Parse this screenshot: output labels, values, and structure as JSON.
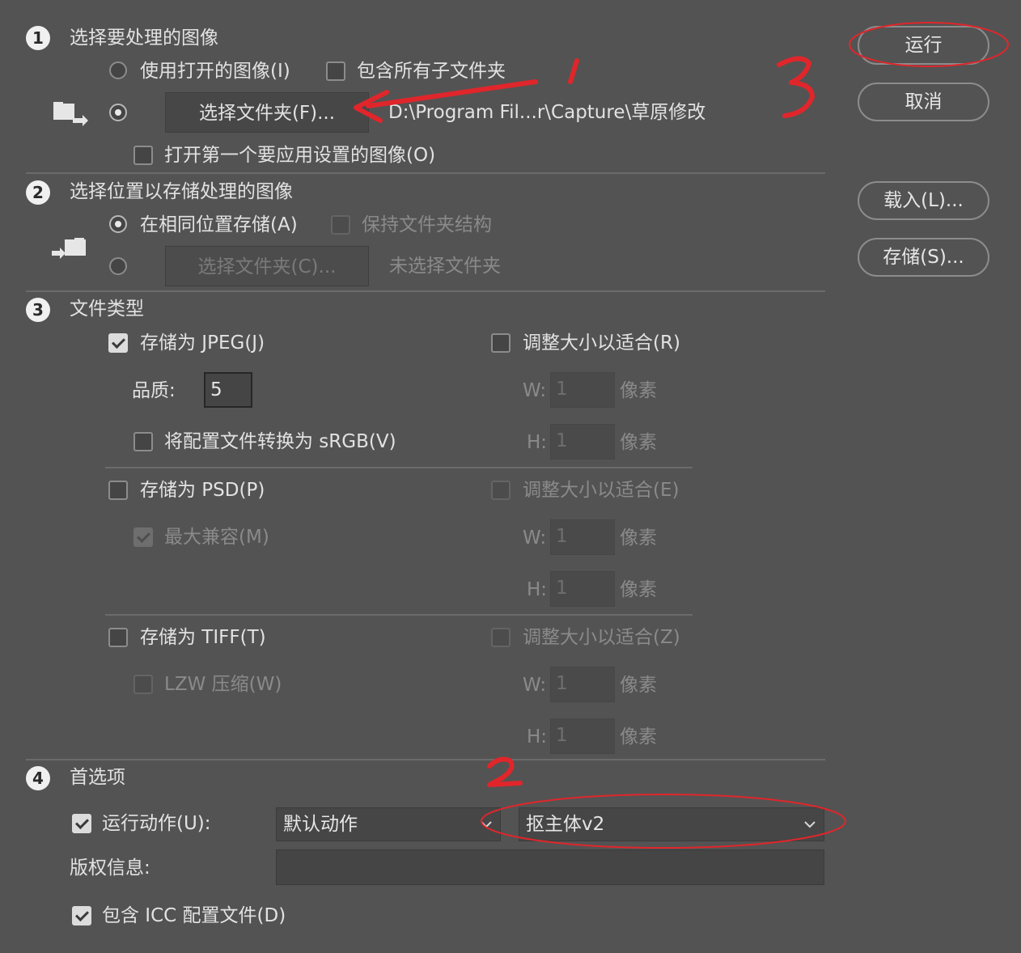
{
  "section1": {
    "number": "1",
    "title": "选择要处理的图像",
    "use_open_images": "使用打开的图像(I)",
    "include_subfolders": "包含所有子文件夹",
    "select_folder_button": "选择文件夹(F)...",
    "folder_path": "D:\\Program Fil...r\\Capture\\草原修改",
    "open_first_image": "打开第一个要应用设置的图像(O)"
  },
  "section2": {
    "number": "2",
    "title": "选择位置以存储处理的图像",
    "save_same_location": "在相同位置存储(A)",
    "keep_folder_structure": "保持文件夹结构",
    "select_folder_button": "选择文件夹(C)...",
    "no_folder_selected": "未选择文件夹"
  },
  "section3": {
    "number": "3",
    "title": "文件类型",
    "jpeg": {
      "save_as": "存储为 JPEG(J)",
      "quality_label": "品质:",
      "quality_value": "5",
      "convert_srgb": "将配置文件转换为 sRGB(V)",
      "resize": "调整大小以适合(R)",
      "w_label": "W:",
      "w_value": "1",
      "w_unit": "像素",
      "h_label": "H:",
      "h_value": "1",
      "h_unit": "像素"
    },
    "psd": {
      "save_as": "存储为 PSD(P)",
      "max_compat": "最大兼容(M)",
      "resize": "调整大小以适合(E)",
      "w_label": "W:",
      "w_value": "1",
      "w_unit": "像素",
      "h_label": "H:",
      "h_value": "1",
      "h_unit": "像素"
    },
    "tiff": {
      "save_as": "存储为 TIFF(T)",
      "lzw": "LZW 压缩(W)",
      "resize": "调整大小以适合(Z)",
      "w_label": "W:",
      "w_value": "1",
      "w_unit": "像素",
      "h_label": "H:",
      "h_value": "1",
      "h_unit": "像素"
    }
  },
  "section4": {
    "number": "4",
    "title": "首选项",
    "run_action_label": "运行动作(U):",
    "action_set": "默认动作",
    "action": "抠主体v2",
    "copyright_label": "版权信息:",
    "copyright_value": "",
    "include_icc": "包含 ICC 配置文件(D)"
  },
  "buttons": {
    "run": "运行",
    "cancel": "取消",
    "load": "载入(L)...",
    "save": "存储(S)..."
  },
  "annotations": {
    "color": "#e0262b",
    "labels": [
      "1",
      "2",
      "3"
    ]
  }
}
